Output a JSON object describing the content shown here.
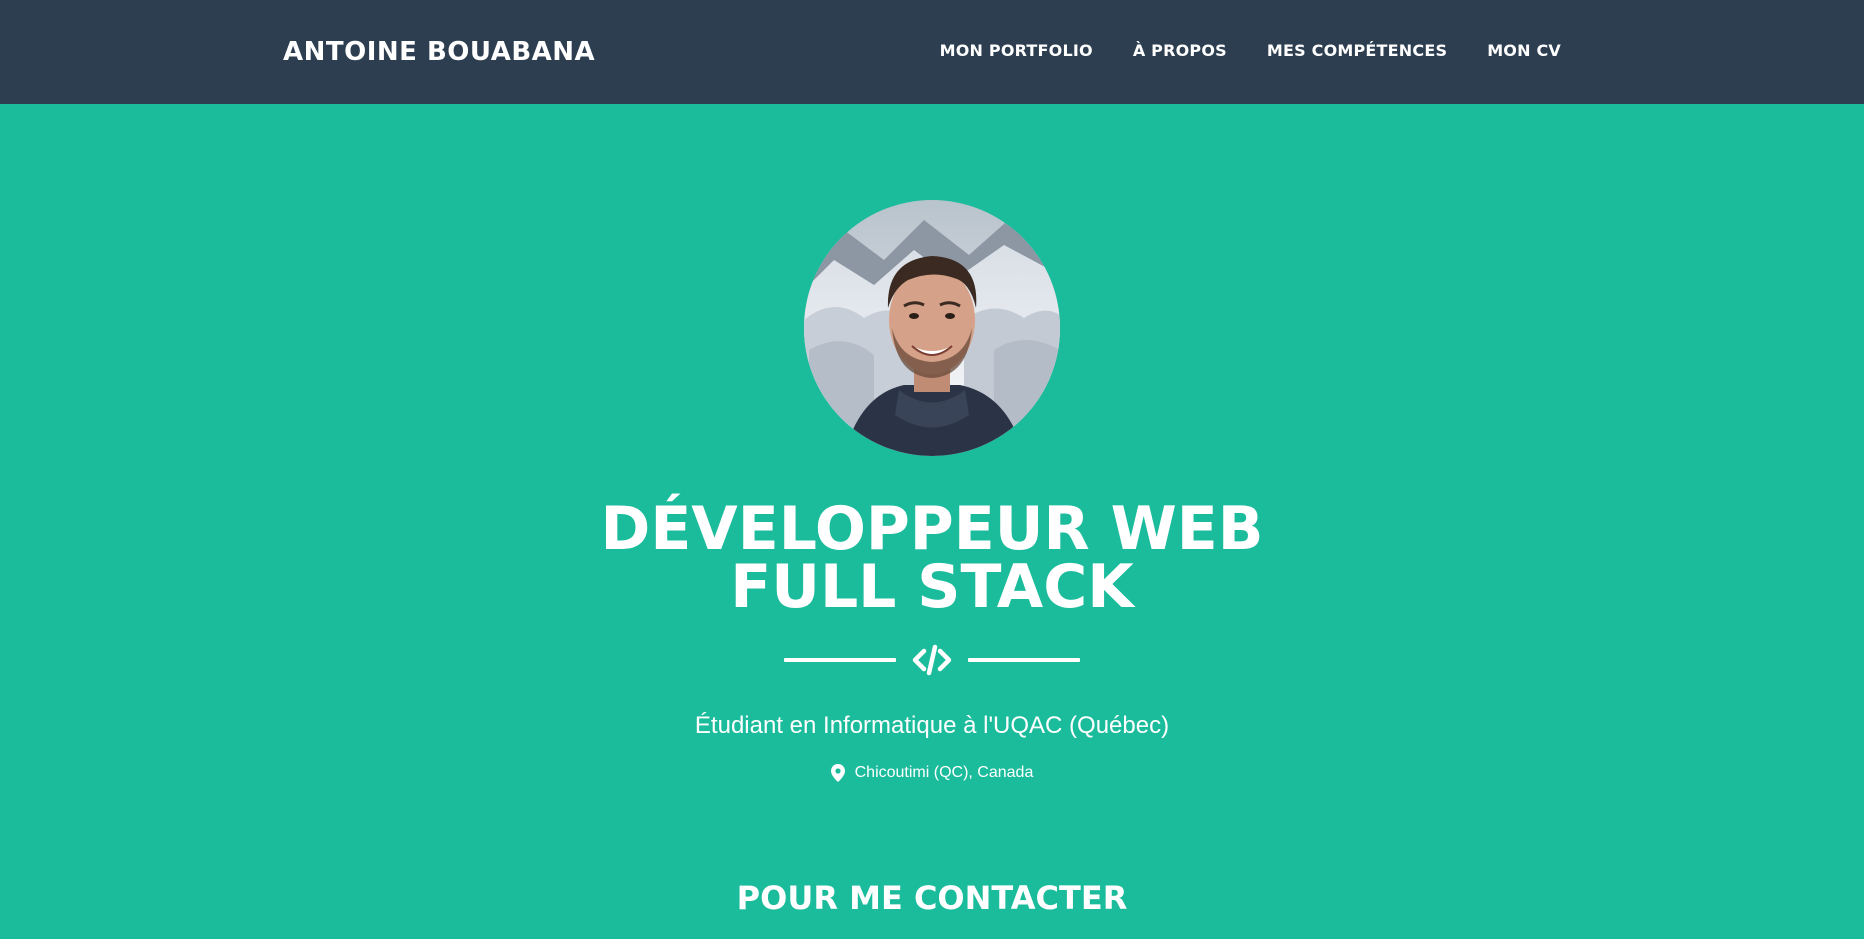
{
  "navbar": {
    "brand": "ANTOINE BOUABANA",
    "items": [
      {
        "label": "MON PORTFOLIO"
      },
      {
        "label": "À PROPOS"
      },
      {
        "label": "MES COMPÉTENCES"
      },
      {
        "label": "MON CV"
      }
    ]
  },
  "hero": {
    "avatar_alt": "profile-photo",
    "headline_line1": "DÉVELOPPEUR WEB",
    "headline_line2": "FULL STACK",
    "divider_icon": "code-icon",
    "subtitle": "Étudiant en Informatique à l'UQAC (Québec)",
    "location": "Chicoutimi (QC), Canada",
    "location_icon": "map-marker-icon"
  },
  "contact": {
    "title": "POUR ME CONTACTER"
  },
  "colors": {
    "navbar_bg": "#2c3e50",
    "hero_bg": "#1abc9c",
    "text": "#ffffff"
  }
}
